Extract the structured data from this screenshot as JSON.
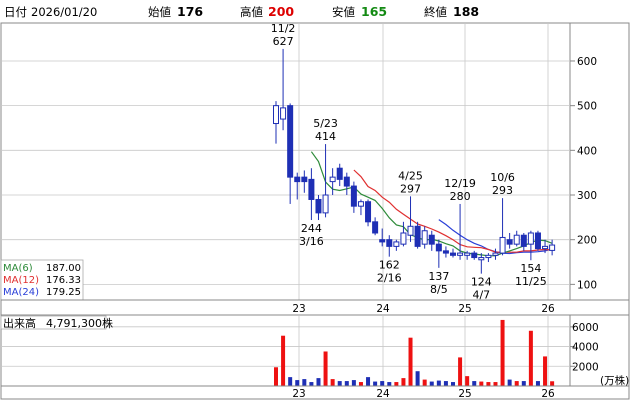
{
  "header": {
    "date_label": "日付",
    "date": "2026/01/20",
    "open_label": "始値",
    "open": "176",
    "high_label": "高値",
    "high": "200",
    "low_label": "安値",
    "low": "165",
    "close_label": "終値",
    "close": "188"
  },
  "colors": {
    "up_candle": "#ffffff",
    "down_candle": "#1e2fb5",
    "ma6": "#2e8b3a",
    "ma12": "#e03030",
    "ma24": "#2a3fd8",
    "volume_up": "#ee1111",
    "volume_down": "#1e2fb5",
    "high_value": "#dd0000",
    "low_value": "#138a13"
  },
  "legend": [
    {
      "label": "MA(6)",
      "value": "187.00",
      "color": "#2e8b3a"
    },
    {
      "label": "MA(12)",
      "value": "176.33",
      "color": "#e03030"
    },
    {
      "label": "MA(24)",
      "value": "179.25",
      "color": "#2a3fd8"
    }
  ],
  "volume_panel": {
    "label": "出来高",
    "value": "4,791,300株",
    "unit": "(万株)"
  },
  "chart_data": [
    {
      "type": "candlestick",
      "x_tick_labels": [
        "23",
        "24",
        "25",
        "26"
      ],
      "y_ticks": [
        100,
        200,
        300,
        400,
        500,
        600
      ],
      "ylim": [
        65,
        685
      ],
      "grid": true,
      "legend_position": "bottom-left",
      "candles": [
        {
          "o": 460,
          "h": 510,
          "l": 415,
          "c": 500
        },
        {
          "o": 470,
          "h": 627,
          "l": 445,
          "c": 495
        },
        {
          "o": 500,
          "h": 505,
          "l": 280,
          "c": 340
        },
        {
          "o": 340,
          "h": 350,
          "l": 290,
          "c": 330
        },
        {
          "o": 340,
          "h": 355,
          "l": 305,
          "c": 330
        },
        {
          "o": 335,
          "h": 360,
          "l": 244,
          "c": 290
        },
        {
          "o": 290,
          "h": 300,
          "l": 244,
          "c": 260
        },
        {
          "o": 260,
          "h": 414,
          "l": 250,
          "c": 300
        },
        {
          "o": 330,
          "h": 360,
          "l": 300,
          "c": 340
        },
        {
          "o": 360,
          "h": 370,
          "l": 320,
          "c": 335
        },
        {
          "o": 340,
          "h": 350,
          "l": 300,
          "c": 320
        },
        {
          "o": 320,
          "h": 330,
          "l": 260,
          "c": 275
        },
        {
          "o": 275,
          "h": 290,
          "l": 255,
          "c": 285
        },
        {
          "o": 285,
          "h": 290,
          "l": 230,
          "c": 240
        },
        {
          "o": 240,
          "h": 250,
          "l": 210,
          "c": 215
        },
        {
          "o": 200,
          "h": 225,
          "l": 185,
          "c": 195
        },
        {
          "o": 200,
          "h": 210,
          "l": 162,
          "c": 185
        },
        {
          "o": 185,
          "h": 200,
          "l": 175,
          "c": 195
        },
        {
          "o": 190,
          "h": 240,
          "l": 185,
          "c": 215
        },
        {
          "o": 210,
          "h": 297,
          "l": 195,
          "c": 230
        },
        {
          "o": 230,
          "h": 240,
          "l": 180,
          "c": 185
        },
        {
          "o": 190,
          "h": 230,
          "l": 180,
          "c": 220
        },
        {
          "o": 210,
          "h": 220,
          "l": 175,
          "c": 190
        },
        {
          "o": 190,
          "h": 200,
          "l": 137,
          "c": 175
        },
        {
          "o": 175,
          "h": 185,
          "l": 160,
          "c": 170
        },
        {
          "o": 170,
          "h": 180,
          "l": 160,
          "c": 165
        },
        {
          "o": 165,
          "h": 280,
          "l": 155,
          "c": 170
        },
        {
          "o": 165,
          "h": 175,
          "l": 155,
          "c": 170
        },
        {
          "o": 170,
          "h": 175,
          "l": 155,
          "c": 160
        },
        {
          "o": 155,
          "h": 170,
          "l": 124,
          "c": 160
        },
        {
          "o": 160,
          "h": 170,
          "l": 150,
          "c": 165
        },
        {
          "o": 165,
          "h": 180,
          "l": 155,
          "c": 170
        },
        {
          "o": 170,
          "h": 293,
          "l": 165,
          "c": 205
        },
        {
          "o": 200,
          "h": 215,
          "l": 180,
          "c": 190
        },
        {
          "o": 190,
          "h": 220,
          "l": 185,
          "c": 210
        },
        {
          "o": 210,
          "h": 215,
          "l": 175,
          "c": 185
        },
        {
          "o": 190,
          "h": 220,
          "l": 154,
          "c": 215
        },
        {
          "o": 215,
          "h": 220,
          "l": 175,
          "c": 180
        },
        {
          "o": 180,
          "h": 200,
          "l": 170,
          "c": 185
        },
        {
          "o": 176,
          "h": 200,
          "l": 165,
          "c": 188
        }
      ],
      "ma6": [
        null,
        null,
        null,
        null,
        null,
        397,
        375,
        329,
        313,
        310,
        314,
        318,
        302,
        295,
        288,
        270,
        249,
        233,
        229,
        211,
        205,
        199,
        201,
        197,
        191,
        186,
        175,
        170,
        168,
        166,
        164,
        164,
        170,
        175,
        180,
        186,
        194,
        199,
        198,
        192
      ],
      "ma12": [
        null,
        null,
        null,
        null,
        null,
        null,
        null,
        null,
        null,
        null,
        null,
        356,
        341,
        319,
        310,
        295,
        284,
        268,
        257,
        246,
        235,
        230,
        224,
        217,
        209,
        200,
        189,
        184,
        183,
        182,
        178,
        172,
        172,
        172,
        172,
        175,
        175,
        177,
        178,
        177
      ],
      "ma24": [
        null,
        null,
        null,
        null,
        null,
        null,
        null,
        null,
        null,
        null,
        null,
        null,
        null,
        null,
        null,
        null,
        null,
        null,
        null,
        null,
        null,
        null,
        null,
        245,
        234,
        221,
        210,
        200,
        192,
        186,
        178,
        173,
        170,
        169,
        171,
        172,
        172,
        173,
        175,
        179
      ],
      "volume": [
        1900,
        5100,
        900,
        600,
        700,
        400,
        800,
        3500,
        700,
        500,
        500,
        600,
        400,
        900,
        450,
        500,
        400,
        400,
        800,
        4900,
        1500,
        650,
        450,
        550,
        500,
        400,
        2900,
        1000,
        500,
        450,
        400,
        400,
        6700,
        650,
        500,
        500,
        5600,
        500,
        3000,
        479
      ],
      "volume_yticks": [
        2000,
        4000,
        6000
      ],
      "volume_ylim": [
        0,
        7200
      ],
      "annotations": [
        {
          "date": "11/2",
          "price": "627",
          "pos": "above",
          "index": 1
        },
        {
          "date": "5/23",
          "price": "414",
          "pos": "above",
          "index": 7
        },
        {
          "date": "3/16",
          "price": "244",
          "pos": "below",
          "index": 5
        },
        {
          "date": "4/25",
          "price": "297",
          "pos": "above",
          "index": 19
        },
        {
          "date": "2/16",
          "price": "162",
          "pos": "below",
          "index": 16
        },
        {
          "date": "12/19",
          "price": "280",
          "pos": "above",
          "index": 26
        },
        {
          "date": "8/5",
          "price": "137",
          "pos": "below",
          "index": 23
        },
        {
          "date": "10/6",
          "price": "293",
          "pos": "above",
          "index": 32
        },
        {
          "date": "4/7",
          "price": "124",
          "pos": "below",
          "index": 29
        },
        {
          "date": "11/25",
          "price": "154",
          "pos": "below",
          "index": 36
        }
      ]
    }
  ]
}
